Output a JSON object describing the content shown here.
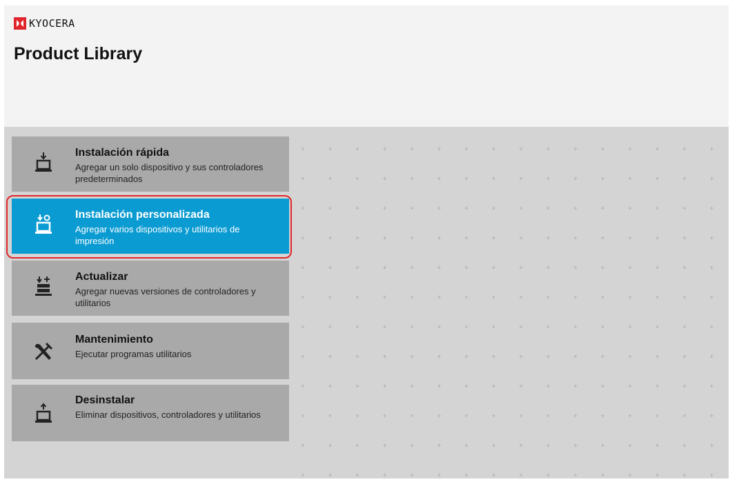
{
  "header": {
    "brand_name": "KYOCERA",
    "title": "Product Library"
  },
  "colors": {
    "header_bg": "#f3f3f3",
    "content_bg": "#d4d4d4",
    "menu_item_bg": "#a9a9a9",
    "menu_item_active_bg": "#0a9bd2",
    "highlight_border": "#e0262b",
    "brand_red": "#e0262b"
  },
  "menu": {
    "items": [
      {
        "label": "Instalación rápida",
        "description": "Agregar un solo dispositivo y sus controladores predeterminados",
        "icon": "quick-install-icon",
        "active": false
      },
      {
        "label": "Instalación personalizada",
        "description": "Agregar varios dispositivos y utilitarios de impresión",
        "icon": "custom-install-icon",
        "active": true
      },
      {
        "label": "Actualizar",
        "description": "Agregar nuevas versiones de controladores y utilitarios",
        "icon": "update-icon",
        "active": false
      },
      {
        "label": "Mantenimiento",
        "description": "Ejecutar programas utilitarios",
        "icon": "maintenance-tools-icon",
        "active": false
      },
      {
        "label": "Desinstalar",
        "description": "Eliminar dispositivos, controladores y utilitarios",
        "icon": "uninstall-icon",
        "active": false
      }
    ]
  }
}
